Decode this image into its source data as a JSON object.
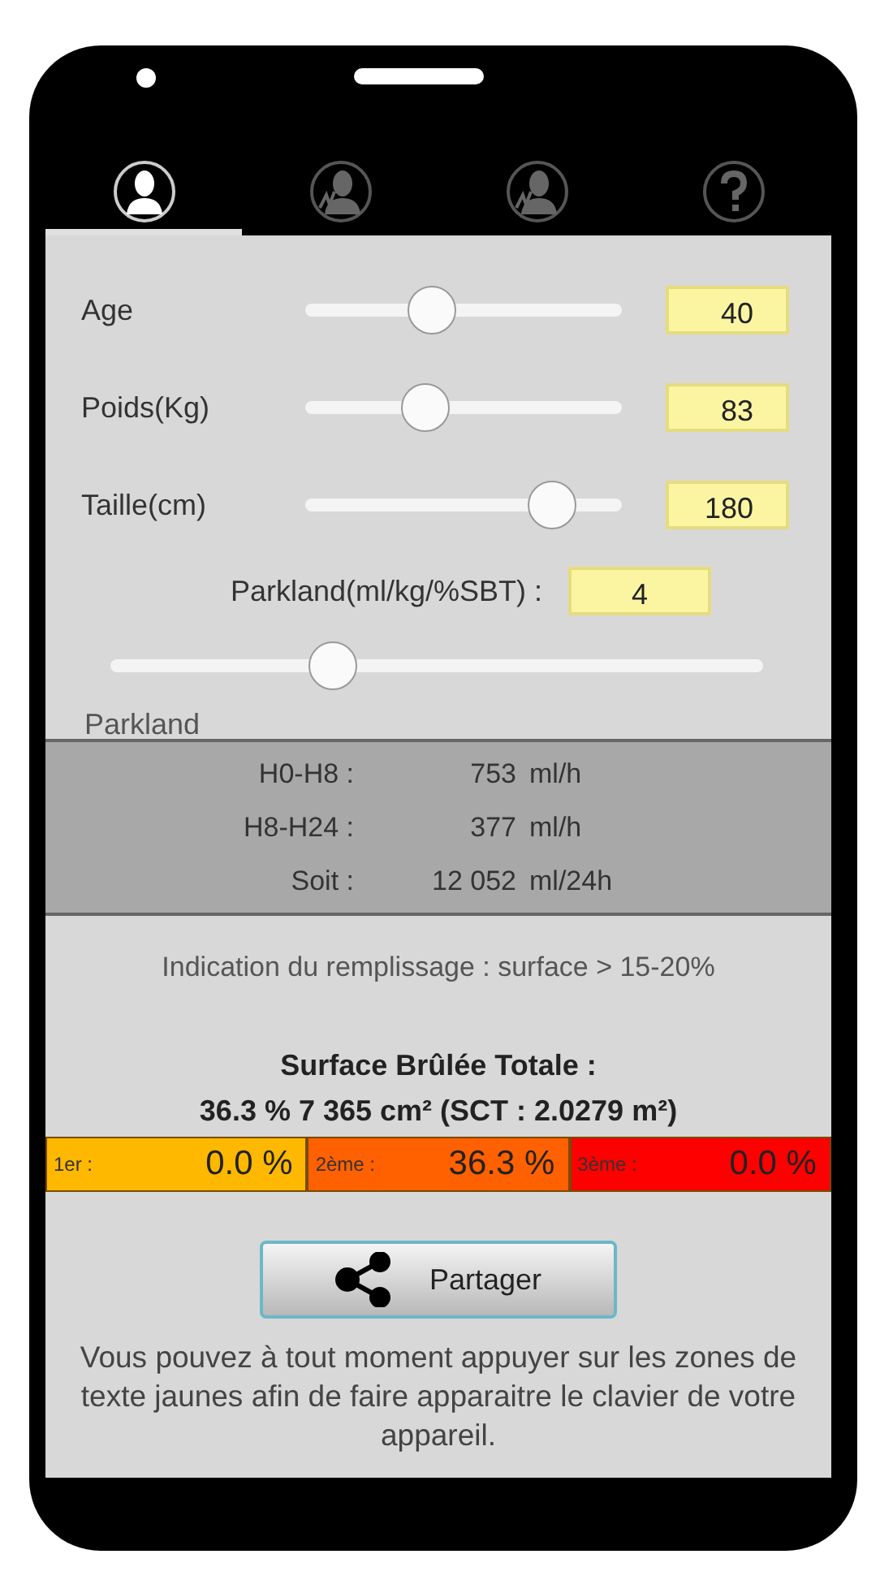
{
  "tabs": [
    {
      "kind": "person",
      "selected": true
    },
    {
      "kind": "person-pulse",
      "selected": false
    },
    {
      "kind": "person-pulse",
      "selected": false
    },
    {
      "kind": "help",
      "selected": false
    }
  ],
  "sliders": [
    {
      "label": "Age",
      "level": 0.4,
      "value": "40"
    },
    {
      "label": "Poids(Kg)",
      "level": 0.38,
      "value": "83"
    },
    {
      "label": "Taille(cm)",
      "level": 0.78,
      "value": "180"
    }
  ],
  "parkland": {
    "label": "Parkland(ml/kg/%SBT) :",
    "value": "4",
    "level": 0.34,
    "caption": "Parkland"
  },
  "results": [
    {
      "label": "H0-H8 :",
      "value": "753",
      "unit": "ml/h"
    },
    {
      "label": "H8-H24 :",
      "value": "377",
      "unit": "ml/h"
    },
    {
      "label": "Soit :",
      "value": "12 052",
      "unit": "ml/24h"
    }
  ],
  "indication": "Indication du remplissage : surface > 15-20%",
  "total_title": "Surface Brûlée Totale :",
  "total_value": "36.3 % 7 365 cm² (SCT : 2.0279 m²)",
  "degrees": [
    {
      "label": "1er :",
      "value": "0.0 %",
      "color": "#ffb800"
    },
    {
      "label": "2ème :",
      "value": "36.3 %",
      "color": "#ff6000"
    },
    {
      "label": "3ème :",
      "value": "0.0 %",
      "color": "#ff0000"
    }
  ],
  "share_button": "Partager",
  "help_text": "Vous pouvez à tout moment appuyer sur les zones de texte jaunes afin de faire apparaitre le clavier de votre appareil."
}
